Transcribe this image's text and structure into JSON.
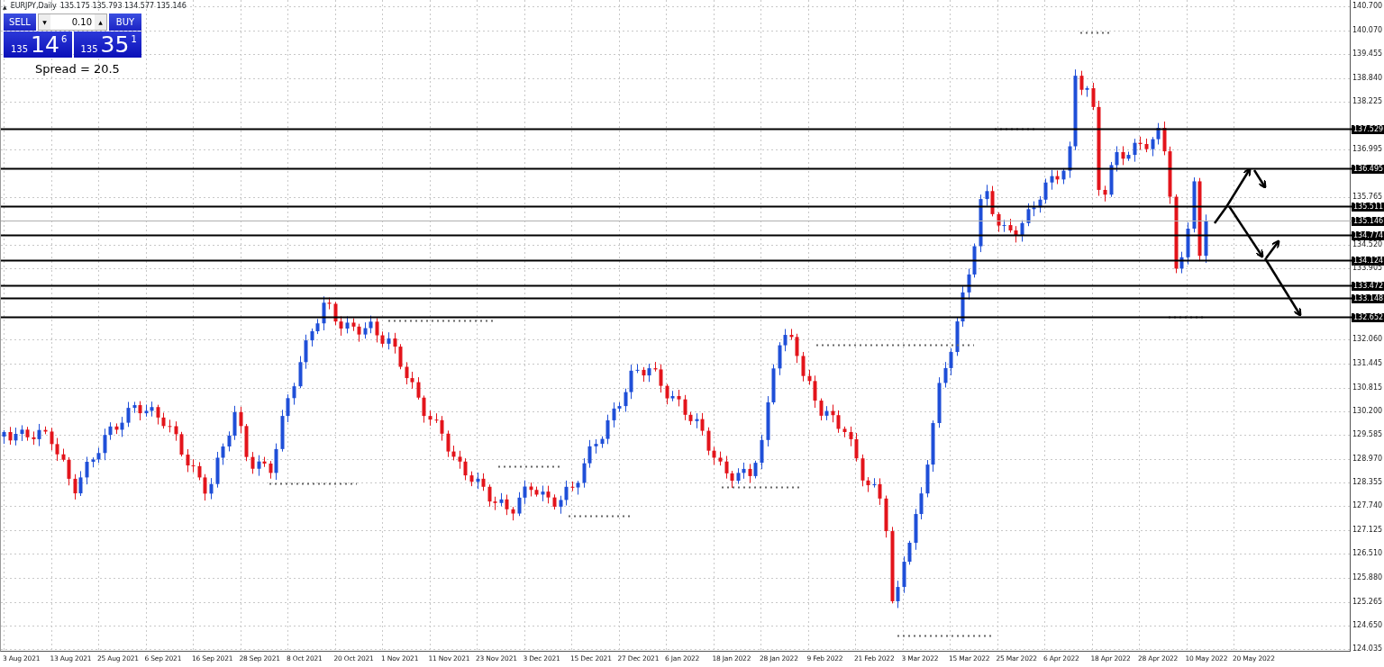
{
  "symbol_bar": {
    "collapse_glyph": "▲",
    "title": "EURJPY,Daily",
    "ohlc": "135.175 135.793 134.577 135.146"
  },
  "trade_panel": {
    "sell_label": "SELL",
    "buy_label": "BUY",
    "lot": "0.10",
    "down_glyph": "▼",
    "up_glyph": "▲",
    "sell_price": {
      "prefix": "135",
      "big": "14",
      "sup": "6"
    },
    "buy_price": {
      "prefix": "135",
      "big": "35",
      "sup": "1"
    },
    "spread": "Spread = 20.5"
  },
  "price_axis": {
    "ticks": [
      "140.700",
      "140.070",
      "139.455",
      "138.840",
      "138.225",
      "136.995",
      "135.765",
      "134.520",
      "133.905",
      "132.060",
      "131.445",
      "130.815",
      "130.200",
      "129.585",
      "128.970",
      "128.355",
      "127.740",
      "127.125",
      "126.510",
      "125.880",
      "125.265",
      "124.650",
      "124.035"
    ]
  },
  "levels": [
    {
      "label": "137.529",
      "kind": "level"
    },
    {
      "label": "136.495",
      "kind": "level"
    },
    {
      "label": "135.511",
      "kind": "level"
    },
    {
      "label": "135.146",
      "kind": "current"
    },
    {
      "label": "134.774",
      "kind": "level"
    },
    {
      "label": "134.124",
      "kind": "level"
    },
    {
      "label": "133.472",
      "kind": "level"
    },
    {
      "label": "133.148",
      "kind": "level"
    },
    {
      "label": "132.652",
      "kind": "level"
    }
  ],
  "date_axis": {
    "labels": [
      "3 Aug 2021",
      "13 Aug 2021",
      "25 Aug 2021",
      "6 Sep 2021",
      "16 Sep 2021",
      "28 Sep 2021",
      "8 Oct 2021",
      "20 Oct 2021",
      "1 Nov 2021",
      "11 Nov 2021",
      "23 Nov 2021",
      "3 Dec 2021",
      "15 Dec 2021",
      "27 Dec 2021",
      "6 Jan 2022",
      "18 Jan 2022",
      "28 Jan 2022",
      "9 Feb 2022",
      "21 Feb 2022",
      "3 Mar 2022",
      "15 Mar 2022",
      "25 Mar 2022",
      "6 Apr 2022",
      "18 Apr 2022",
      "28 Apr 2022",
      "10 May 2022",
      "20 May 2022"
    ]
  }
}
